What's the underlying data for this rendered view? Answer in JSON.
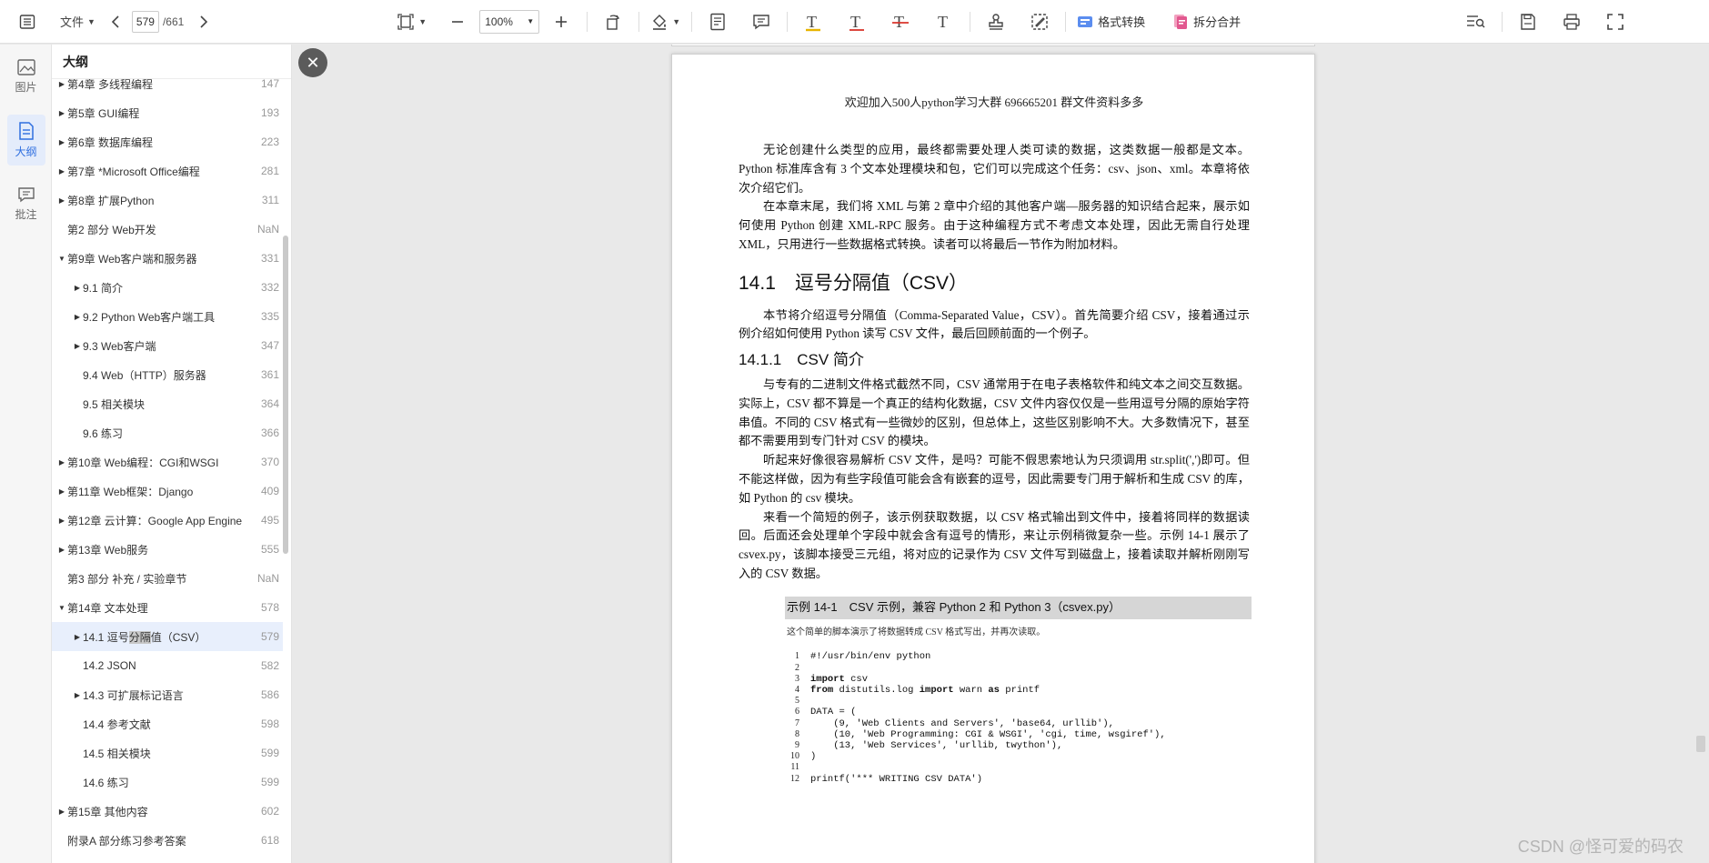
{
  "toolbar": {
    "file_menu": "文件",
    "current_page": "579",
    "total_pages": "/661",
    "zoom": "100%",
    "format_convert": "格式转换",
    "split_merge": "拆分合并"
  },
  "rail": {
    "images": "图片",
    "outline": "大纲",
    "annotations": "批注"
  },
  "outline": {
    "title": "大纲",
    "items": [
      {
        "label": "第4章 多线程编程",
        "page": "147",
        "arrow": "right",
        "level": 0
      },
      {
        "label": "第5章 GUI编程",
        "page": "193",
        "arrow": "right",
        "level": 0
      },
      {
        "label": "第6章 数据库编程",
        "page": "223",
        "arrow": "right",
        "level": 0
      },
      {
        "label": "第7章 *Microsoft Office编程",
        "page": "281",
        "arrow": "right",
        "level": 0
      },
      {
        "label": "第8章 扩展Python",
        "page": "311",
        "arrow": "right",
        "level": 0
      },
      {
        "label": "第2 部分 Web开发",
        "page": "NaN",
        "arrow": "none",
        "level": 0
      },
      {
        "label": "第9章 Web客户端和服务器",
        "page": "331",
        "arrow": "down",
        "level": 0
      },
      {
        "label": "9.1 简介",
        "page": "332",
        "arrow": "right",
        "level": 1
      },
      {
        "label": "9.2 Python Web客户端工具",
        "page": "335",
        "arrow": "right",
        "level": 1
      },
      {
        "label": "9.3 Web客户端",
        "page": "347",
        "arrow": "right",
        "level": 1
      },
      {
        "label": "9.4 Web（HTTP）服务器",
        "page": "361",
        "arrow": "none",
        "level": 1
      },
      {
        "label": "9.5 相关模块",
        "page": "364",
        "arrow": "none",
        "level": 1
      },
      {
        "label": "9.6 练习",
        "page": "366",
        "arrow": "none",
        "level": 1
      },
      {
        "label": "第10章 Web编程：CGI和WSGI",
        "page": "370",
        "arrow": "right",
        "level": 0
      },
      {
        "label": "第11章 Web框架：Django",
        "page": "409",
        "arrow": "right",
        "level": 0
      },
      {
        "label": "第12章 云计算：Google App Engine",
        "page": "495",
        "arrow": "right",
        "level": 0
      },
      {
        "label": "第13章 Web服务",
        "page": "555",
        "arrow": "right",
        "level": 0
      },
      {
        "label": "第3 部分 补充 / 实验章节",
        "page": "NaN",
        "arrow": "none",
        "level": 0
      },
      {
        "label": "第14章 文本处理",
        "page": "578",
        "arrow": "down",
        "level": 0
      },
      {
        "label_pre": "14.1 逗号",
        "label_hl": "分隔",
        "label_post": "值（CSV）",
        "page": "579",
        "arrow": "right",
        "level": 1,
        "selected": true
      },
      {
        "label": "14.2 JSON",
        "page": "582",
        "arrow": "none",
        "level": 1
      },
      {
        "label": "14.3 可扩展标记语言",
        "page": "586",
        "arrow": "right",
        "level": 1
      },
      {
        "label": "14.4 参考文献",
        "page": "598",
        "arrow": "none",
        "level": 1
      },
      {
        "label": "14.5 相关模块",
        "page": "599",
        "arrow": "none",
        "level": 1
      },
      {
        "label": "14.6 练习",
        "page": "599",
        "arrow": "none",
        "level": 1
      },
      {
        "label": "第15章 其他内容",
        "page": "602",
        "arrow": "right",
        "level": 0
      },
      {
        "label": "附录A 部分练习参考答案",
        "page": "618",
        "arrow": "none",
        "level": 0
      }
    ]
  },
  "document": {
    "header": "欢迎加入500人python学习大群 696665201 群文件资料多多",
    "paragraphs_intro": [
      "无论创建什么类型的应用，最终都需要处理人类可读的数据，这类数据一般都是文本。Python 标准库含有 3 个文本处理模块和包，它们可以完成这个任务：csv、json、xml。本章将依次介绍它们。",
      "在本章末尾，我们将 XML 与第 2 章中介绍的其他客户端—服务器的知识结合起来，展示如何使用 Python 创建 XML-RPC 服务。由于这种编程方式不考虑文本处理，因此无需自行处理 XML，只用进行一些数据格式转换。读者可以将最后一节作为附加材料。"
    ],
    "section_title": "14.1　逗号分隔值（CSV）",
    "section_para": "本节将介绍逗号分隔值（Comma-Separated Value，CSV）。首先简要介绍 CSV，接着通过示例介绍如何使用 Python 读写 CSV 文件，最后回顾前面的一个例子。",
    "subsection_title": "14.1.1　CSV 简介",
    "subsection_paras": [
      "与专有的二进制文件格式截然不同，CSV 通常用于在电子表格软件和纯文本之间交互数据。实际上，CSV 都不算是一个真正的结构化数据，CSV 文件内容仅仅是一些用逗号分隔的原始字符串值。不同的 CSV 格式有一些微妙的区别，但总体上，这些区别影响不大。大多数情况下，甚至都不需要用到专门针对 CSV 的模块。",
      "听起来好像很容易解析 CSV 文件，是吗？可能不假思索地认为只须调用 str.split(',')即可。但不能这样做，因为有些字段值可能会含有嵌套的逗号，因此需要专门用于解析和生成 CSV 的库，如 Python 的 csv 模块。",
      "来看一个简短的例子，该示例获取数据，以 CSV 格式输出到文件中，接着将同样的数据读回。后面还会处理单个字段中就会含有逗号的情形，来让示例稍微复杂一些。示例 14-1 展示了 csvex.py，该脚本接受三元组，将对应的记录作为 CSV 文件写到磁盘上，接着读取并解析刚刚写入的 CSV 数据。"
    ],
    "example_title": "示例 14-1　CSV 示例，兼容 Python 2 和 Python 3（csvex.py）",
    "example_desc": "这个简单的脚本演示了将数据转成 CSV 格式写出，并再次读取。",
    "code_lines": [
      {
        "n": "1",
        "t": "#!/usr/bin/env python"
      },
      {
        "n": "2",
        "t": ""
      },
      {
        "n": "3",
        "kw": "import",
        "t": " csv"
      },
      {
        "n": "4",
        "kw": "from",
        "t": " distutils.log ",
        "kw2": "import",
        "t2": " warn ",
        "kw3": "as",
        "t3": " printf"
      },
      {
        "n": "5",
        "t": ""
      },
      {
        "n": "6",
        "t": "DATA = ("
      },
      {
        "n": "7",
        "t": "    (9, 'Web Clients and Servers', 'base64, urllib'),"
      },
      {
        "n": "8",
        "t": "    (10, 'Web Programming: CGI & WSGI', 'cgi, time, wsgiref'),"
      },
      {
        "n": "9",
        "t": "    (13, 'Web Services', 'urllib, twython'),"
      },
      {
        "n": "10",
        "t": ")"
      },
      {
        "n": "11",
        "t": ""
      },
      {
        "n": "12",
        "t": "printf('*** WRITING CSV DATA')"
      }
    ]
  },
  "watermark": "CSDN @怪可爱的码农",
  "colors": {
    "accent": "#2f6fe0",
    "selected_row": "#e8effc",
    "text_tool_yellow": "#e8b400",
    "text_tool_red": "#d9342b"
  }
}
